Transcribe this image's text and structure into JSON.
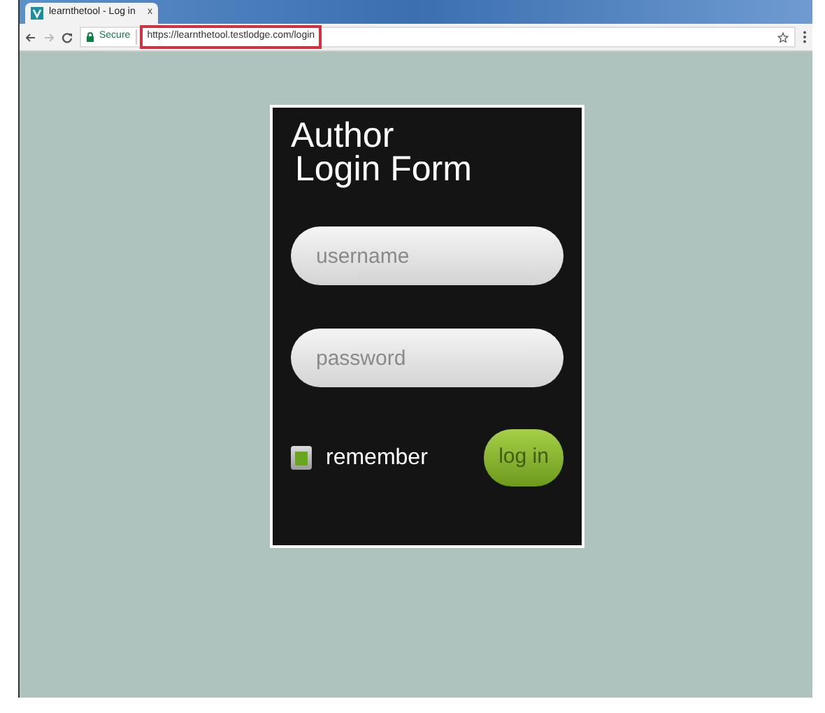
{
  "browser": {
    "tab": {
      "title": "learnthetool - Log in",
      "close": "x"
    },
    "secure_label": "Secure",
    "url": "https://learnthetool.testlodge.com/login",
    "url_highlighted": true
  },
  "login_form": {
    "title_line_1": "Author",
    "title_line_2": "Login Form",
    "username": {
      "placeholder": "username"
    },
    "password": {
      "placeholder": "password"
    },
    "remember": {
      "label": "remember",
      "checked": true
    },
    "submit": "log in"
  }
}
